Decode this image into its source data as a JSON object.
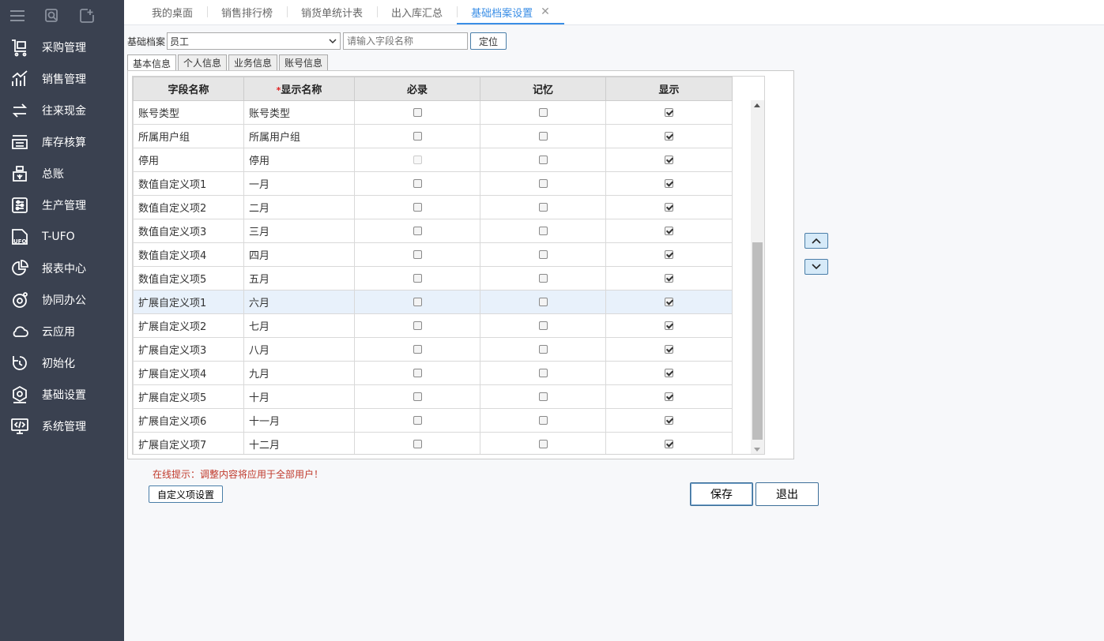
{
  "sidebar": {
    "top_icons": [
      "menu-icon",
      "search-doc-icon",
      "add-tab-icon"
    ],
    "items": [
      {
        "label": "采购管理",
        "icon": "cart-icon"
      },
      {
        "label": "销售管理",
        "icon": "sales-chart-icon"
      },
      {
        "label": "往来现金",
        "icon": "exchange-icon"
      },
      {
        "label": "库存核算",
        "icon": "warehouse-icon"
      },
      {
        "label": "总账",
        "icon": "ledger-icon"
      },
      {
        "label": "生产管理",
        "icon": "production-icon"
      },
      {
        "label": "T-UFO",
        "icon": "ufo-icon"
      },
      {
        "label": "报表中心",
        "icon": "pie-chart-icon"
      },
      {
        "label": "协同办公",
        "icon": "collab-icon"
      },
      {
        "label": "云应用",
        "icon": "cloud-icon"
      },
      {
        "label": "初始化",
        "icon": "refresh-icon"
      },
      {
        "label": "基础设置",
        "icon": "settings-icon"
      },
      {
        "label": "系统管理",
        "icon": "system-icon"
      }
    ]
  },
  "tabs": [
    {
      "label": "我的桌面"
    },
    {
      "label": "销售排行榜"
    },
    {
      "label": "销货单统计表"
    },
    {
      "label": "出入库汇总"
    },
    {
      "label": "基础档案设置",
      "active": true
    }
  ],
  "toolbar": {
    "archive_label": "基础档案",
    "archive_value": "员工",
    "search_placeholder": "请输入字段名称",
    "locate_label": "定位"
  },
  "subtabs": [
    {
      "label": "基本信息",
      "active": true
    },
    {
      "label": "个人信息"
    },
    {
      "label": "业务信息"
    },
    {
      "label": "账号信息"
    }
  ],
  "grid": {
    "headers": {
      "field": "字段名称",
      "required_star": "*",
      "display_name": "显示名称",
      "mandatory": "必录",
      "memory": "记忆",
      "show": "显示"
    },
    "rows": [
      {
        "field": "账号类型",
        "display": "账号类型",
        "mandatory": false,
        "memory": false,
        "show": true
      },
      {
        "field": "所属用户组",
        "display": "所属用户组",
        "mandatory": false,
        "memory": false,
        "show": true
      },
      {
        "field": "停用",
        "display": "停用",
        "mandatory": false,
        "mandatory_disabled": true,
        "memory": false,
        "show": true
      },
      {
        "field": "数值自定义项1",
        "display": "一月",
        "mandatory": false,
        "memory": false,
        "show": true
      },
      {
        "field": "数值自定义项2",
        "display": "二月",
        "mandatory": false,
        "memory": false,
        "show": true
      },
      {
        "field": "数值自定义项3",
        "display": "三月",
        "mandatory": false,
        "memory": false,
        "show": true
      },
      {
        "field": "数值自定义项4",
        "display": "四月",
        "mandatory": false,
        "memory": false,
        "show": true
      },
      {
        "field": "数值自定义项5",
        "display": "五月",
        "mandatory": false,
        "memory": false,
        "show": true
      },
      {
        "field": "扩展自定义项1",
        "display": "六月",
        "mandatory": false,
        "memory": false,
        "show": true,
        "highlighted": true
      },
      {
        "field": "扩展自定义项2",
        "display": "七月",
        "mandatory": false,
        "memory": false,
        "show": true
      },
      {
        "field": "扩展自定义项3",
        "display": "八月",
        "mandatory": false,
        "memory": false,
        "show": true
      },
      {
        "field": "扩展自定义项4",
        "display": "九月",
        "mandatory": false,
        "memory": false,
        "show": true
      },
      {
        "field": "扩展自定义项5",
        "display": "十月",
        "mandatory": false,
        "memory": false,
        "show": true
      },
      {
        "field": "扩展自定义项6",
        "display": "十一月",
        "mandatory": false,
        "memory": false,
        "show": true
      },
      {
        "field": "扩展自定义项7",
        "display": "十二月",
        "mandatory": false,
        "memory": false,
        "show": true
      }
    ]
  },
  "tip": "在线提示：调整内容将应用于全部用户！",
  "buttons": {
    "custom": "自定义项设置",
    "save": "保存",
    "exit": "退出"
  },
  "colors": {
    "sidebar_bg": "#3a4150",
    "accent": "#3a8ee6",
    "tip": "#c0392b"
  }
}
